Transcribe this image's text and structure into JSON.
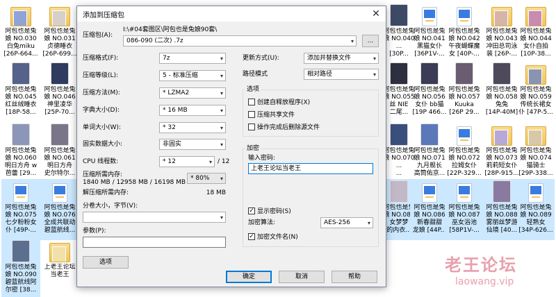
{
  "desktop": {
    "icons": [
      {
        "label": "阿包也是兔\n娘 NO.030\n白兔miku\n[26P-664...",
        "kind": "folder",
        "color": "#8fa3d6"
      },
      {
        "label": "阿包也是兔\n娘 NO.031\n贞德睡衣\n[26P-699...",
        "kind": "folder",
        "color": "#d6d0c8"
      },
      {
        "label": "阿包也是兔\n娘 NO.045\n红丝绒睡衣\n[18P-58...",
        "kind": "pic",
        "color": "#55628a"
      },
      {
        "label": "阿包也是兔\n娘 NO.046\n神里凌华\n[25P-70...",
        "kind": "pic",
        "color": "#2f3c5f"
      },
      {
        "label": "阿包也是兔\n娘 NO.060\n明日方舟 w\n芭蕾 [29...",
        "kind": "pic",
        "color": "#8c96b8"
      },
      {
        "label": "阿包也是兔\n娘 NO.061\n明日方舟\n史尔特尔...",
        "kind": "pic",
        "color": "#7a7588"
      },
      {
        "label": "阿包也是兔\n娘 NO.075\n七夕粉粉女\n仆 [49P-...",
        "kind": "file",
        "color": ""
      },
      {
        "label": "阿包也是兔\n娘 NO.076\n全成共联动\n碧蓝航线...",
        "kind": "file",
        "color": ""
      },
      {
        "label": "阿包也是兔\n娘 NO.090\n碧蓝航线阿\n尔密 [38...",
        "kind": "pic",
        "color": "#5c6f8f"
      },
      {
        "label": "上老王论坛\n当老王",
        "kind": "folder",
        "color": "#f1e0a8"
      },
      {
        "label": "阿包也是兔\n娘 NO.040\n...\n[30P...",
        "kind": "pic",
        "color": "#3d4a66"
      },
      {
        "label": "阿包也是兔\n娘 NO.041\n黑猫女仆\n[36P1V-...",
        "kind": "file",
        "color": ""
      },
      {
        "label": "阿包也是兔\n娘 NO.042\n午夜蝴蝶魔\n女 [40P-...",
        "kind": "file",
        "color": ""
      },
      {
        "label": "阿包也是兔\n娘 NO.043\n冲田总司泳\n装 [26P-...",
        "kind": "folder",
        "color": "#d4b5a8"
      },
      {
        "label": "阿包也是兔\n娘 NO.044\n女仆自拍\n[10P-38...",
        "kind": "folder",
        "color": "#c98bb0"
      },
      {
        "label": "阿包也是兔\n娘 NO.055\n丝 NIE\n二尾...",
        "kind": "pic",
        "color": "#2e2f3f"
      },
      {
        "label": "阿包也是兔\n娘 NO.056\n女仆 bb猫\n[19P 466...",
        "kind": "pic",
        "color": "#3a3d55"
      },
      {
        "label": "阿包也是兔\n娘 NO.057\nKuuka\n[26P 29...",
        "kind": "pic",
        "color": "#6a5d72"
      },
      {
        "label": "阿包也是兔\n娘 NO.058\n兔兔\n[14P-40M]",
        "kind": "pic",
        "color": "#4e4a5c"
      },
      {
        "label": "阿包也是兔\n娘 NO.059\n传统长裙女\n仆 [47P-5...",
        "kind": "folder",
        "color": "#8a94b0"
      },
      {
        "label": "阿包也是兔\n娘 NO.070\n...\n...",
        "kind": "pic",
        "color": "#3b4f7d"
      },
      {
        "label": "阿包也是兔\n娘 NO.071\n九月舰长\n高筒佑京...",
        "kind": "pic",
        "color": "#5b78b8"
      },
      {
        "label": "阿包也是兔\n娘 NO.072\n拉姆女仆\n[22P-329...",
        "kind": "file",
        "color": ""
      },
      {
        "label": "阿包也是兔\n娘 NO.073\n莉莉短女仆\n[28P-915...",
        "kind": "folder",
        "color": "#b8a8d8"
      },
      {
        "label": "阿包也是兔\n娘 NO.074\n猫骑士\n[29P-338...",
        "kind": "folder",
        "color": "#d8c8a8"
      },
      {
        "label": "阿包也是兔\n娘 NO.085\n女梦梦\n的内衣...",
        "kind": "pic",
        "color": "#c2b8c8"
      },
      {
        "label": "阿包也是兔\n娘 NO.086\n新春甜甜\n龙娘 [44P...",
        "kind": "file",
        "color": ""
      },
      {
        "label": "阿包也是兔\n娘 NO.087\n巫女浴池\n[58P1V-...",
        "kind": "file",
        "color": ""
      },
      {
        "label": "阿包也是兔\n娘 NO.088\n雾丽丝梦游\n仙境 [40...",
        "kind": "pic",
        "color": "#8a7aa0"
      },
      {
        "label": "阿包也是兔\n娘 NO.089\n轻熟女\n[34P-626...",
        "kind": "file",
        "color": ""
      }
    ]
  },
  "dialog": {
    "title": "添加到压缩包",
    "close_glyph": "✕",
    "archive_label": "压缩包(A):",
    "archive_path": "I:\\#04套图区\\阿包也是兔娘90套\\",
    "archive_name": "086-090 (二次) .7z",
    "browse_label": "...",
    "format_label": "压缩格式(F):",
    "format_value": "7z",
    "level_label": "压缩等级(L):",
    "level_value": "5 - 标准压缩",
    "method_label": "压缩方法(M):",
    "method_value": "* LZMA2",
    "dict_label": "字典大小(D):",
    "dict_value": "* 16 MB",
    "word_label": "单词大小(W):",
    "word_value": "* 32",
    "solid_label": "固实数据大小:",
    "solid_value": "非固实",
    "cpu_label": "CPU 线程数:",
    "cpu_value": "* 12",
    "cpu_total": "/ 12",
    "mem_label": "压缩所需内存:",
    "mem_value": "1840 MB / 12958 MB / 16198 MB",
    "mem_percent": "* 80%",
    "demem_label": "解压缩所需内存:",
    "demem_value": "18 MB",
    "split_label": "分卷大小，字节(V):",
    "params_label": "参数(P):",
    "options_button": "选项",
    "update_label": "更新方式(U):",
    "update_value": "添加并替换文件",
    "path_label": "路径模式",
    "path_value": "相对路径",
    "options_group": "选项",
    "opt_sfx": "创建自释放程序(X)",
    "opt_shared": "压缩共享文件",
    "opt_delete": "操作完成后删除源文件",
    "encrypt_group": "加密",
    "password_label": "输入密码:",
    "password_value": "上老王论坛当老王",
    "show_password": "显示密码(S)",
    "enc_method_label": "加密算法:",
    "enc_method_value": "AES-256",
    "enc_names": "加密文件名(N)",
    "check_mark": "✓",
    "ok_button": "确定",
    "cancel_button": "取消",
    "help_button": "帮助"
  },
  "watermark": {
    "title": "老王论坛",
    "url": "laowang.vip"
  }
}
